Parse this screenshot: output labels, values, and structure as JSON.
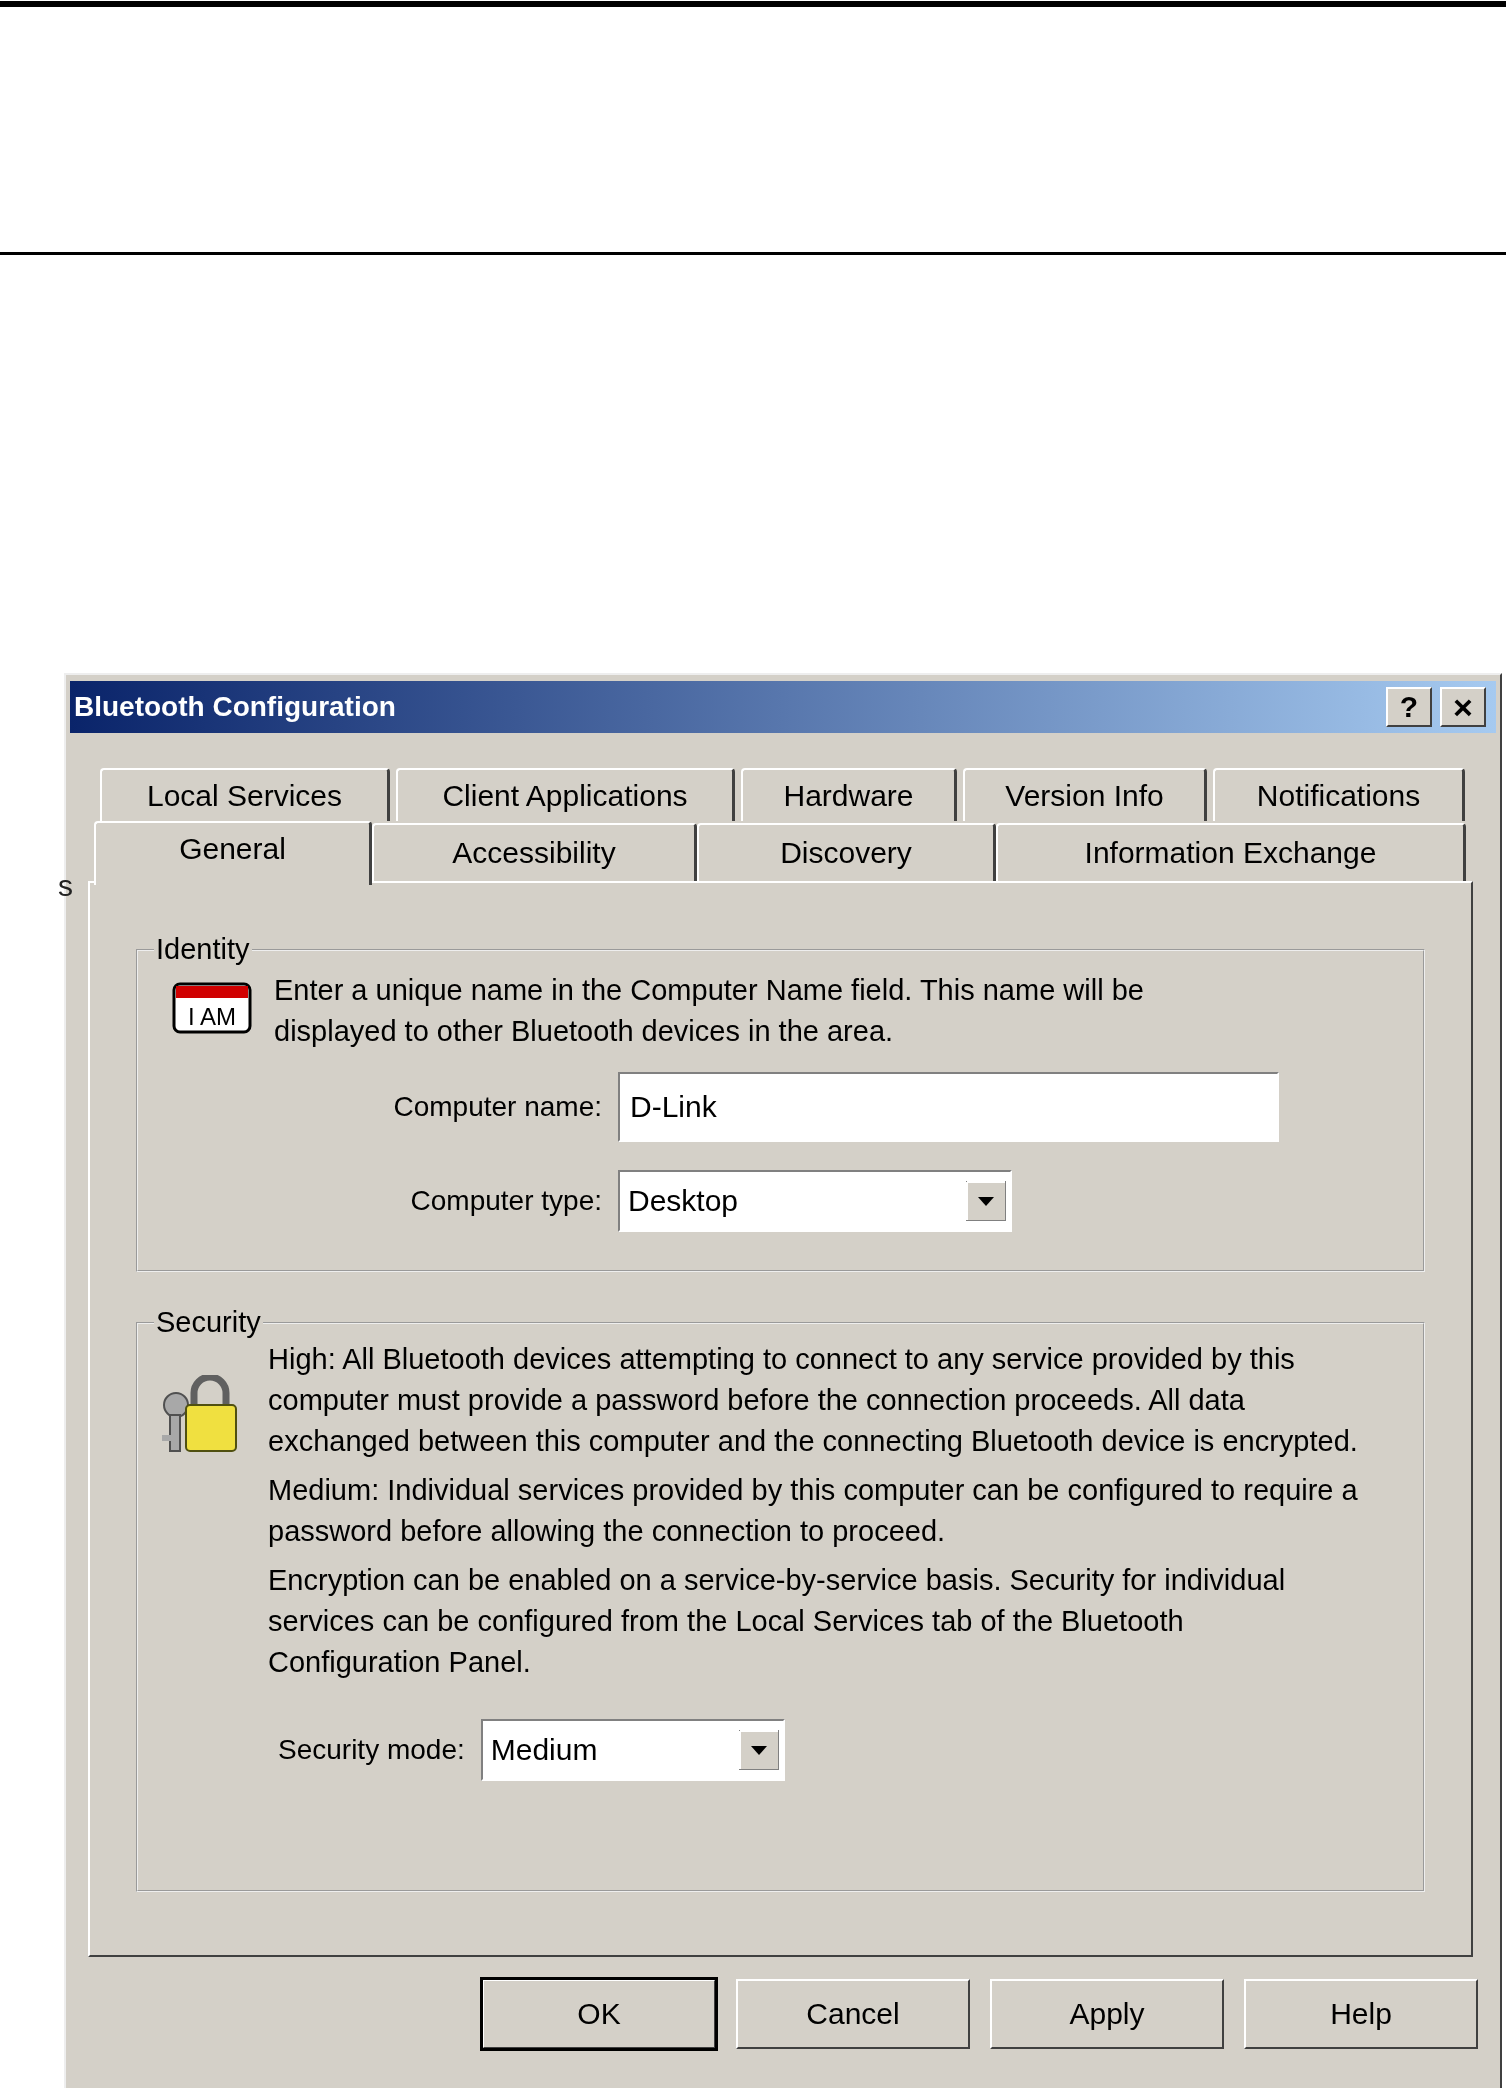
{
  "page": {
    "fragment": "s"
  },
  "window": {
    "title": "Bluetooth Configuration",
    "controls": [
      {
        "kind": "help",
        "label": "?"
      },
      {
        "kind": "close",
        "label": "×"
      }
    ]
  },
  "tabs": {
    "rows": [
      [
        {
          "label": "Local Services",
          "selected": false
        },
        {
          "label": "Client Applications",
          "selected": false
        },
        {
          "label": "Hardware",
          "selected": false
        },
        {
          "label": "Version Info",
          "selected": false
        },
        {
          "label": "Notifications",
          "selected": false
        }
      ],
      [
        {
          "label": "General",
          "selected": true
        },
        {
          "label": "Accessibility",
          "selected": false
        },
        {
          "label": "Discovery",
          "selected": false
        },
        {
          "label": "Information Exchange",
          "selected": false
        }
      ]
    ]
  },
  "identity": {
    "title": "Identity",
    "icon_text": "I AM",
    "description": "Enter a unique name in the Computer Name field. This name will be displayed to other Bluetooth devices in the area.",
    "fields": [
      {
        "kind": "text",
        "label": "Computer name:",
        "value": "D-Link"
      },
      {
        "kind": "combo",
        "label": "Computer type:",
        "value": "Desktop"
      }
    ]
  },
  "security": {
    "title": "Security",
    "paragraphs": [
      "High: All Bluetooth devices attempting to connect to any service provided by this computer must provide a password before the connection proceeds. All data exchanged between this computer and the connecting Bluetooth device is encrypted.",
      "Medium: Individual services provided by this computer can be configured to require a password before allowing the connection to proceed.",
      "Encryption can be enabled on a service-by-service basis. Security for individual services can be configured from the Local Services tab of the Bluetooth Configuration Panel."
    ],
    "mode": {
      "label": "Security mode:",
      "value": "Medium"
    }
  },
  "buttons": [
    {
      "label": "OK",
      "default": true
    },
    {
      "label": "Cancel",
      "default": false
    },
    {
      "label": "Apply",
      "default": false
    },
    {
      "label": "Help",
      "default": false
    }
  ]
}
